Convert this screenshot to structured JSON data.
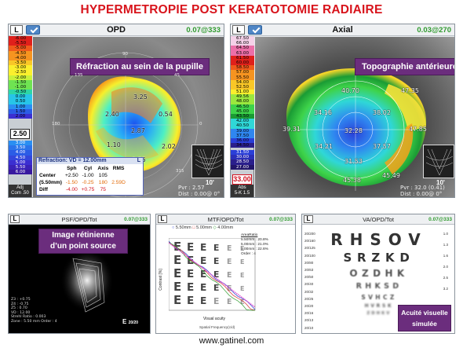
{
  "title": "HYPERMETROPIE POST KERATOTOMIE RADIAIRE",
  "footer": "www.gatinel.com",
  "panels": {
    "opd": {
      "eye_label": "L",
      "title": "OPD",
      "coord": "0.07@333",
      "callout": "Réfraction au sein de la pupille",
      "scale_values": [
        "-6.00",
        "-5.50",
        "-5.00",
        "-4.50",
        "-4.00",
        "-3.50",
        "-3.00",
        "-2.50",
        "-2.00",
        "-1.50",
        "-1.00",
        "-0.50",
        "0.00",
        "0.50",
        "1.00",
        "1.50",
        "2.00"
      ],
      "scale_lower": [
        "3.00",
        "3.50",
        "4.00",
        "4.50",
        "5.00",
        "5.50",
        "6.00"
      ],
      "current": "2.50",
      "scale_foot_1": "Adj",
      "scale_foot_2": "Com .50",
      "map_values": [
        "3.25",
        "2.40",
        "0.54",
        "2.87",
        "1.10",
        "2.02",
        "3.55"
      ],
      "ticks": [
        "90",
        "135",
        "45",
        "180",
        "0",
        "225",
        "315",
        "270"
      ],
      "inset_label": "10'",
      "pvr": "Pvr : 2.57",
      "dist": "Dist : 0.00@ 0°",
      "refraction": {
        "title": "Refraction: VD = 12.00mm",
        "eye": "L",
        "headers": [
          "",
          "Sph",
          "Cyl",
          "Axis",
          "RMS"
        ],
        "rows": [
          [
            "Center",
            "+2.50",
            "-1.00",
            "105",
            ""
          ],
          [
            "(5.50mm)",
            "-1.50",
            "-0.25",
            "180",
            "2.59D"
          ],
          [
            "Diff",
            "-4.00",
            "+0.75",
            "75",
            ""
          ]
        ]
      }
    },
    "axial": {
      "eye_label": "L",
      "title": "Axial",
      "coord": "0.03@270",
      "callout": "Topographie  antérieure",
      "scale_values": [
        "67.50",
        "66.00",
        "64.50",
        "63.00",
        "61.50",
        "60.00",
        "58.50",
        "57.00",
        "55.50",
        "54.00",
        "52.50",
        "51.00",
        "49.56",
        "48.00",
        "46.50",
        "45.00",
        "43.50",
        "42.00",
        "40.50",
        "39.00",
        "37.50",
        "36.00",
        "34.50"
      ],
      "scale_lower": [
        "31.50",
        "30.00",
        "28.50",
        "27.00"
      ],
      "current": "33.00",
      "scale_foot_1": "Abs",
      "scale_foot_2": "5-K 1.5",
      "map_values": [
        "40.70",
        "47.35",
        "34.16",
        "38.02",
        "39.31",
        "32.28",
        "47.85",
        "34.21",
        "37.57",
        "31.53",
        "45.49",
        "45.38"
      ],
      "inset_label": "10'",
      "pvr": "Pvr : 32.0 (0.41)",
      "dist": "Dist : 0.00@ 0°"
    },
    "psf": {
      "eye_label": "L",
      "title": "PSF/OPD/Tot",
      "coord": "0.07@333",
      "callout_line1": "Image rétinienne",
      "callout_line2": "d’un point source",
      "stats": [
        "Z3 : +0.75",
        "Z4 : -0.75",
        "Z5 : 0.70",
        "VD : 12.00",
        "Strehl Ratio : 0.003",
        "Zone : 5.50 mm Order : 4"
      ],
      "badge": "20/20"
    },
    "mtf": {
      "eye_label": "L",
      "title": "MTF/OPD/Tot",
      "coord": "0.07@333",
      "legend": [
        "5.50mm",
        "5.00mm",
        "4.00mm"
      ],
      "area_ratio_title": "AreaRatio",
      "area_ratio": [
        "5.50mm : 20.8%",
        "5.00mm : 21.0%",
        "4.00mm : 22.6%"
      ],
      "order": "Order : 4",
      "ylabel": "Contrast [%]",
      "xlabel": "Visual acuity",
      "xlabel2": "Spatial Frequency(c/d)",
      "chart_letter": "E"
    },
    "va": {
      "eye_label": "L",
      "title": "VA/OPD/Tot",
      "coord": "0.07@333",
      "rows": [
        "RHSOV",
        "SRZKD",
        "OZDHK",
        "RHKSD",
        "SVHCZ",
        "HVRSK",
        "ZDHKV"
      ],
      "snellen": [
        "20/200",
        "20/160",
        "20/125",
        "20/100",
        "20/80",
        "20/63",
        "20/50",
        "20/40",
        "20/32",
        "20/25",
        "20/20",
        "20/16",
        "20/13",
        "20/10"
      ],
      "side": [
        "1.0",
        "1.3",
        "1.6",
        "2.0",
        "2.5",
        "3.2"
      ],
      "callout_line1": "Acuité visuelle",
      "callout_line2": "simulée"
    }
  },
  "colors": {
    "title_red": "#d8141c",
    "callout_purple": "#6b2d7d",
    "coord_green": "#2f9a2e"
  }
}
